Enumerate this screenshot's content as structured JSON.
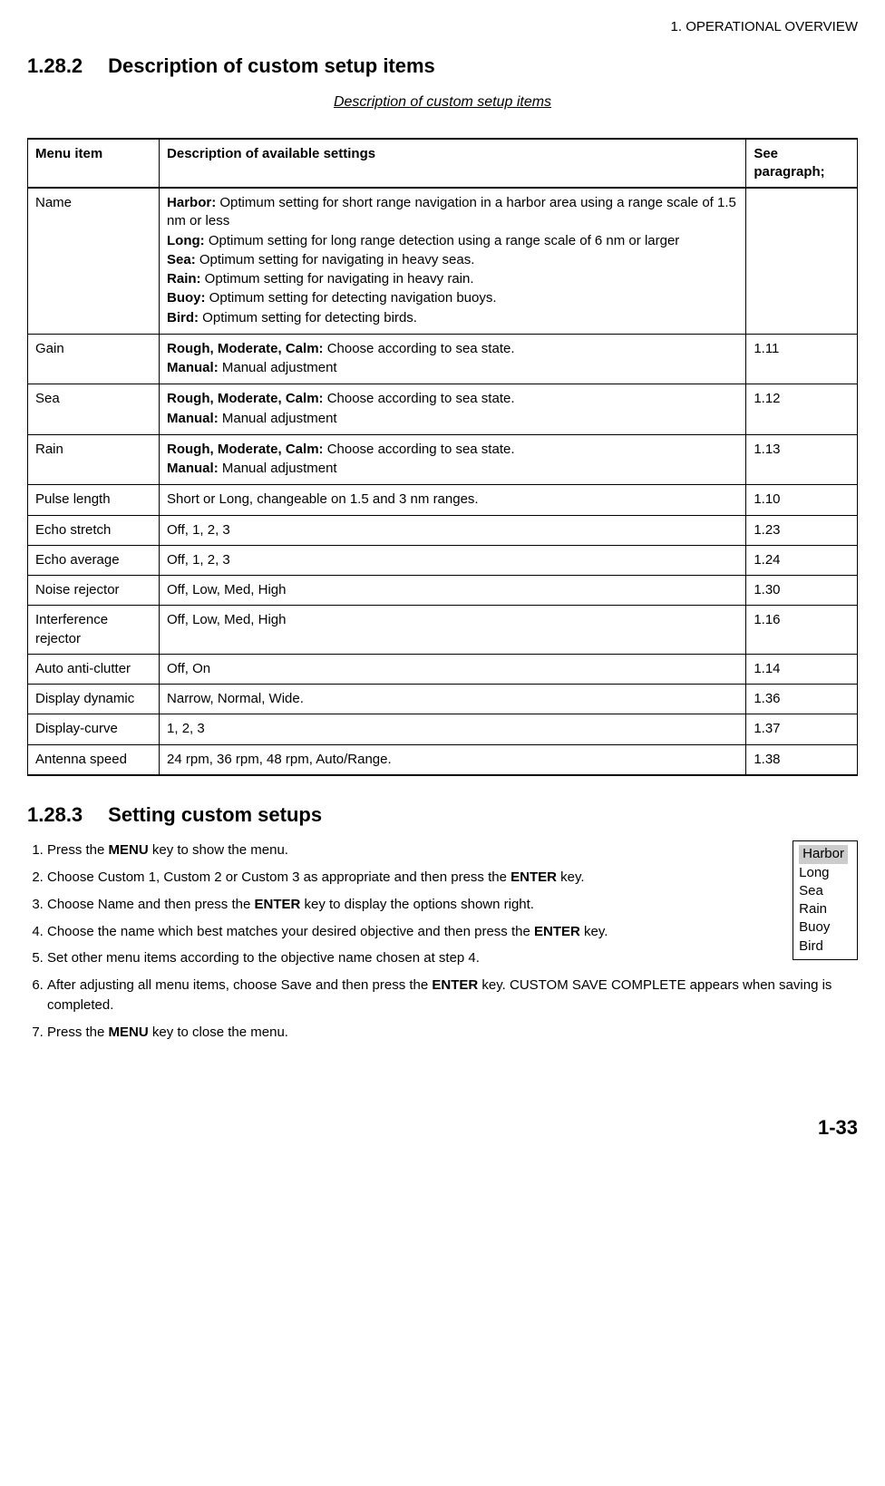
{
  "header": {
    "running": "1. OPERATIONAL OVERVIEW"
  },
  "section1": {
    "num": "1.28.2",
    "title": "Description of custom setup items",
    "caption": "Description of custom setup items"
  },
  "table": {
    "head": {
      "c1": "Menu item",
      "c2": "Description of available settings",
      "c3": "See paragraph;"
    },
    "rows": [
      {
        "item": "Name",
        "desc": [
          {
            "b": "Harbor:",
            "t": " Optimum setting for short range navigation in a harbor area using a range scale of 1.5 nm or less"
          },
          {
            "b": "Long:",
            "t": " Optimum setting for long range detection using a range scale of 6 nm or larger"
          },
          {
            "b": "Sea:",
            "t": " Optimum setting for navigating in heavy seas."
          },
          {
            "b": "Rain:",
            "t": " Optimum setting for navigating in heavy rain."
          },
          {
            "b": "Buoy:",
            "t": " Optimum setting for detecting navigation buoys."
          },
          {
            "b": "Bird:",
            "t": " Optimum setting for detecting birds."
          }
        ],
        "ref": ""
      },
      {
        "item": "Gain",
        "desc": [
          {
            "b": "Rough, Moderate, Calm:",
            "t": " Choose according to sea state."
          },
          {
            "b": "Manual:",
            "t": " Manual adjustment"
          }
        ],
        "ref": "1.11"
      },
      {
        "item": "Sea",
        "desc": [
          {
            "b": "Rough, Moderate, Calm:",
            "t": " Choose according to sea state."
          },
          {
            "b": "Manual:",
            "t": " Manual adjustment"
          }
        ],
        "ref": "1.12"
      },
      {
        "item": "Rain",
        "desc": [
          {
            "b": "Rough, Moderate, Calm:",
            "t": " Choose according to sea state."
          },
          {
            "b": "Manual:",
            "t": " Manual adjustment"
          }
        ],
        "ref": "1.13"
      },
      {
        "item": "Pulse length",
        "plain": "Short or Long, changeable on 1.5 and 3 nm ranges.",
        "ref": "1.10"
      },
      {
        "item": "Echo stretch",
        "plain": "Off, 1, 2, 3",
        "ref": "1.23"
      },
      {
        "item": "Echo average",
        "plain": "Off, 1, 2, 3",
        "ref": "1.24"
      },
      {
        "item": "Noise rejector",
        "plain": "Off, Low, Med, High",
        "ref": "1.30"
      },
      {
        "item": "Interference rejector",
        "plain": "Off, Low, Med, High",
        "ref": "1.16"
      },
      {
        "item": "Auto anti-clutter",
        "plain": "Off, On",
        "ref": "1.14"
      },
      {
        "item": "Display dynamic",
        "plain": "Narrow, Normal, Wide.",
        "ref": "1.36"
      },
      {
        "item": "Display-curve",
        "plain": "1, 2, 3",
        "ref": "1.37"
      },
      {
        "item": "Antenna speed",
        "plain": "24 rpm, 36 rpm, 48 rpm, Auto/Range.",
        "ref": "1.38"
      }
    ]
  },
  "section2": {
    "num": "1.28.3",
    "title": "Setting custom setups"
  },
  "steps": [
    {
      "pre": "Press the ",
      "b1": "MENU",
      "post": " key to show the menu."
    },
    {
      "pre": "Choose Custom 1, Custom 2 or Custom 3 as appropriate and then press the ",
      "b1": "ENTER",
      "post": " key."
    },
    {
      "pre": "Choose Name and then press the ",
      "b1": "ENTER",
      "post": " key to display the options shown right."
    },
    {
      "pre": "Choose the name which best matches your desired objective and then press the ",
      "b1": "ENTER",
      "post": " key."
    },
    {
      "pre": "Set other menu items according to the objective name chosen at step 4.",
      "b1": "",
      "post": ""
    },
    {
      "pre": "After adjusting all menu items, choose Save and then press the ",
      "b1": "ENTER",
      "post": " key. CUSTOM SAVE COMPLETE appears when saving is completed."
    },
    {
      "pre": "Press the ",
      "b1": "MENU",
      "post": " key to close the menu."
    }
  ],
  "options": {
    "items": [
      "Harbor",
      "Long",
      "Sea",
      "Rain",
      "Buoy",
      "Bird"
    ],
    "selected": 0
  },
  "footer": {
    "page": "1-33"
  }
}
